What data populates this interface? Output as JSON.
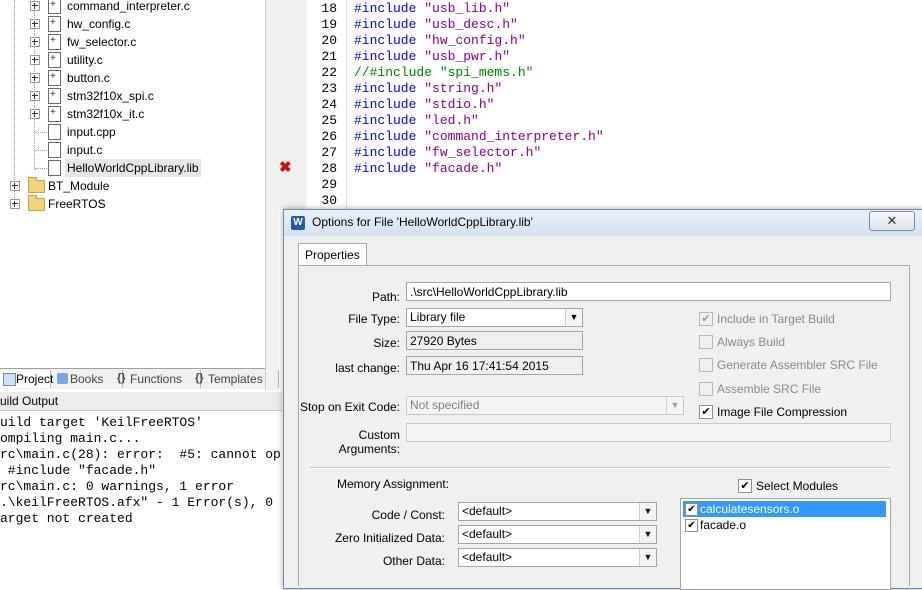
{
  "tree": {
    "items": [
      {
        "label": "command_interpreter.c",
        "kind": "file"
      },
      {
        "label": "hw_config.c",
        "kind": "file"
      },
      {
        "label": "fw_selector.c",
        "kind": "file"
      },
      {
        "label": "utility.c",
        "kind": "file"
      },
      {
        "label": "button.c",
        "kind": "file"
      },
      {
        "label": "stm32f10x_spi.c",
        "kind": "file"
      },
      {
        "label": "stm32f10x_it.c",
        "kind": "file"
      },
      {
        "label": "input.cpp",
        "kind": "file"
      },
      {
        "label": "input.c",
        "kind": "file"
      },
      {
        "label": "HelloWorldCppLibrary.lib",
        "kind": "file"
      },
      {
        "label": "BT_Module",
        "kind": "folder"
      },
      {
        "label": "FreeRTOS",
        "kind": "folder"
      }
    ]
  },
  "project_tabs": [
    {
      "label": "Project"
    },
    {
      "label": "Books"
    },
    {
      "label": "Functions"
    },
    {
      "label": "Templates"
    }
  ],
  "build_output": {
    "title": "uild Output",
    "lines": [
      "uild target 'KeilFreeRTOS'",
      "ompiling main.c...",
      "rc\\main.c(28): error:  #5: cannot op",
      " #include \"facade.h\"",
      "rc\\main.c: 0 warnings, 1 error",
      ".\\keilFreeRTOS.afx\" - 1 Error(s), 0",
      "arget not created"
    ]
  },
  "editor": {
    "lines": [
      {
        "num": "18",
        "kw": "#include",
        "str": "\"usb_lib.h\"",
        "comment": false
      },
      {
        "num": "19",
        "kw": "#include",
        "str": "\"usb_desc.h\"",
        "comment": false
      },
      {
        "num": "20",
        "kw": "#include",
        "str": "\"hw_config.h\"",
        "comment": false
      },
      {
        "num": "21",
        "kw": "#include",
        "str": "\"usb_pwr.h\"",
        "comment": false
      },
      {
        "num": "22",
        "kw": "//#include",
        "str": "\"spi_mems.h\"",
        "comment": true
      },
      {
        "num": "23",
        "kw": "#include",
        "str": "\"string.h\"",
        "comment": false
      },
      {
        "num": "24",
        "kw": "#include",
        "str": "\"stdio.h\"",
        "comment": false
      },
      {
        "num": "25",
        "kw": "#include",
        "str": "\"led.h\"",
        "comment": false
      },
      {
        "num": "26",
        "kw": "#include",
        "str": "\"command_interpreter.h\"",
        "comment": false
      },
      {
        "num": "27",
        "kw": "#include",
        "str": "\"fw_selector.h\"",
        "comment": false
      },
      {
        "num": "28",
        "kw": "#include",
        "str": "\"facade.h\"",
        "comment": false
      },
      {
        "num": "29",
        "kw": "",
        "str": "",
        "comment": false
      },
      {
        "num": "30",
        "kw": "",
        "str": "",
        "comment": false
      }
    ],
    "error_marker": "✖"
  },
  "dialog": {
    "icon": "W",
    "title": "Options for File 'HelloWorldCppLibrary.lib'",
    "close_label": "✕",
    "tab": "Properties",
    "path_label": "Path:",
    "path_value": ".\\src\\HelloWorldCppLibrary.lib",
    "file_type_label": "File Type:",
    "file_type_value": "Library file",
    "size_label": "Size:",
    "size_value": "27920 Bytes",
    "last_change_label": "last change:",
    "last_change_value": "Thu Apr 16 17:41:54 2015",
    "stop_label": "Stop on Exit Code:",
    "stop_value": "Not specified",
    "custom_args_label": "Custom Arguments:",
    "custom_args_value": "",
    "checks": [
      {
        "label": "Include in Target Build",
        "checked": true,
        "disabled": true
      },
      {
        "label": "Always Build",
        "checked": false,
        "disabled": true
      },
      {
        "label": "Generate Assembler SRC File",
        "checked": false,
        "disabled": true
      },
      {
        "label": "Assemble SRC File",
        "checked": false,
        "disabled": true
      },
      {
        "label": "Image File Compression",
        "checked": true,
        "disabled": false
      }
    ],
    "memory_label": "Memory Assignment:",
    "select_modules_label": "Select Modules",
    "select_modules_checked": true,
    "code_const_label": "Code / Const:",
    "code_const_value": "<default>",
    "zero_init_label": "Zero Initialized Data:",
    "zero_init_value": "<default>",
    "other_data_label": "Other Data:",
    "other_data_value": "<default>",
    "modules": [
      {
        "label": "calculatesensors.o",
        "checked": true,
        "selected": true
      },
      {
        "label": "facade.o",
        "checked": true,
        "selected": false
      }
    ]
  },
  "colors": {
    "keyword": "#0000ff",
    "string": "#8b008b",
    "comment": "#008000",
    "selection": "#3399ff",
    "error": "#d01010"
  }
}
